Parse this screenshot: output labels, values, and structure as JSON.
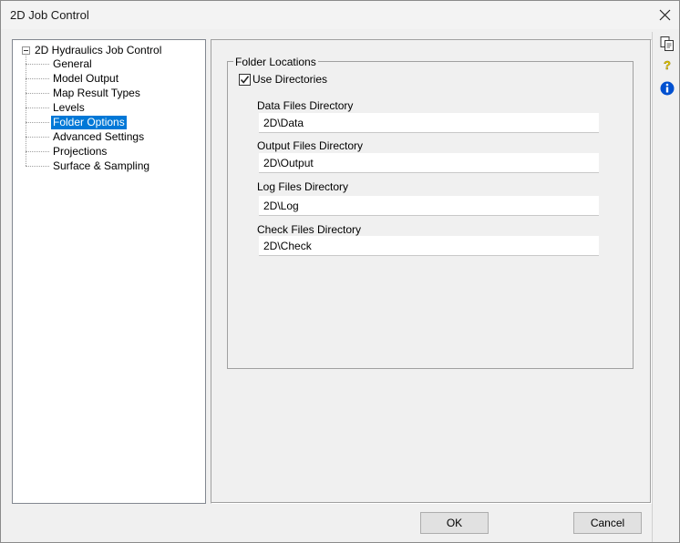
{
  "window": {
    "title": "2D Job Control"
  },
  "tree": {
    "root": "2D Hydraulics Job Control",
    "items": [
      {
        "label": "General",
        "selected": false
      },
      {
        "label": "Model Output",
        "selected": false
      },
      {
        "label": "Map Result Types",
        "selected": false
      },
      {
        "label": "Levels",
        "selected": false
      },
      {
        "label": "Folder Options",
        "selected": true
      },
      {
        "label": "Advanced Settings",
        "selected": false
      },
      {
        "label": "Projections",
        "selected": false
      },
      {
        "label": "Surface & Sampling",
        "selected": false
      }
    ]
  },
  "folder_locations": {
    "legend": "Folder Locations",
    "use_directories_label": "Use Directories",
    "use_directories_checked": true,
    "data_label": "Data Files Directory",
    "data_value": "2D\\Data",
    "output_label": "Output Files Directory",
    "output_value": "2D\\Output",
    "log_label": "Log Files Directory",
    "log_value": "2D\\Log",
    "check_label": "Check Files Directory",
    "check_value": "2D\\Check"
  },
  "side_icons": [
    "copy-icon",
    "help-icon",
    "info-icon"
  ],
  "buttons": {
    "ok": "OK",
    "cancel": "Cancel"
  },
  "colors": {
    "selection": "#0078d7",
    "info": "#0050d0",
    "help": "#e6c800"
  }
}
